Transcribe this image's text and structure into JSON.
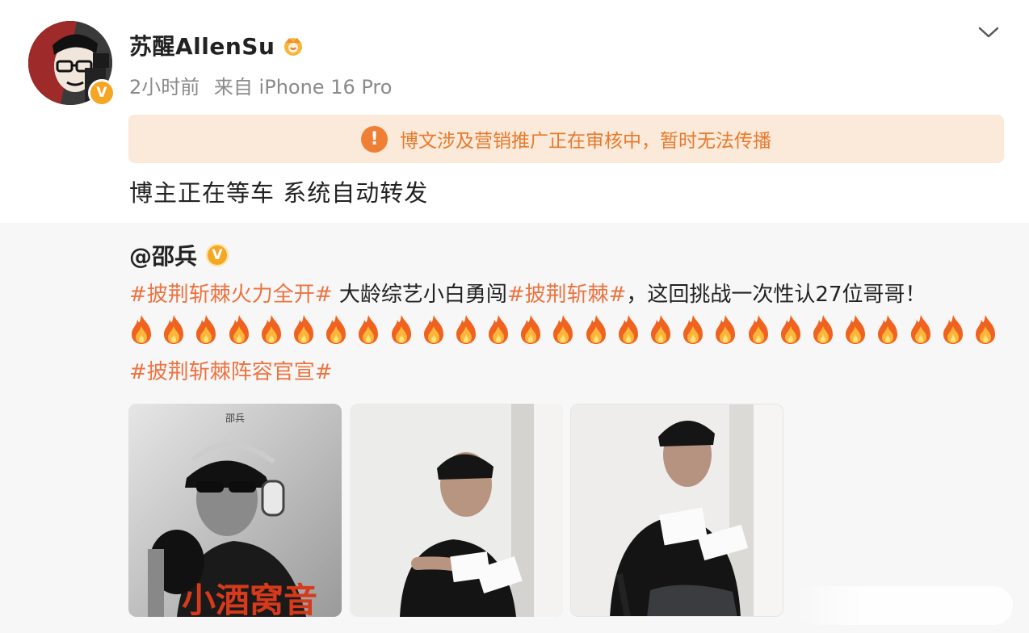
{
  "post": {
    "author": "苏醒AllenSu",
    "time": "2小时前",
    "source": "来自 iPhone 16 Pro",
    "review_notice": "博文涉及营销推广正在审核中，暂时无法传播",
    "text": "博主正在等车 系统自动转发"
  },
  "repost": {
    "author": "@邵兵",
    "hashtag1": "#披荆斩棘火力全开#",
    "text1": " 大龄综艺小白勇闯",
    "hashtag2": "#披荆斩棘#",
    "text2": "，这回挑战一次性认27位哥哥！",
    "fire_count": 27,
    "hashtag3": "#披荆斩棘阵容官宣#",
    "photos": [
      {
        "caption_top": "邵兵",
        "caption_bottom": "小酒窝音"
      },
      {
        "caption_top": "",
        "caption_bottom": ""
      },
      {
        "caption_top": "",
        "caption_bottom": ""
      }
    ]
  },
  "icons": {
    "verify_badge": "V",
    "warning": "!"
  },
  "colors": {
    "hashtag": "#eb7340",
    "review_bg": "#fbe9da",
    "review_text": "#e77a2c",
    "badge": "#f5a623"
  }
}
